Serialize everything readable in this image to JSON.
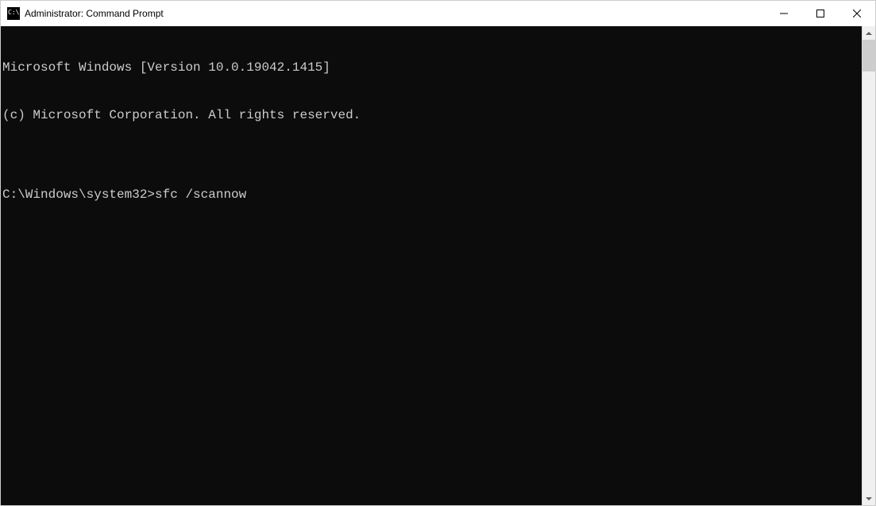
{
  "window": {
    "title": "Administrator: Command Prompt"
  },
  "terminal": {
    "line1": "Microsoft Windows [Version 10.0.19042.1415]",
    "line2": "(c) Microsoft Corporation. All rights reserved.",
    "blank": "",
    "prompt": "C:\\Windows\\system32>",
    "command": "sfc /scannow"
  }
}
